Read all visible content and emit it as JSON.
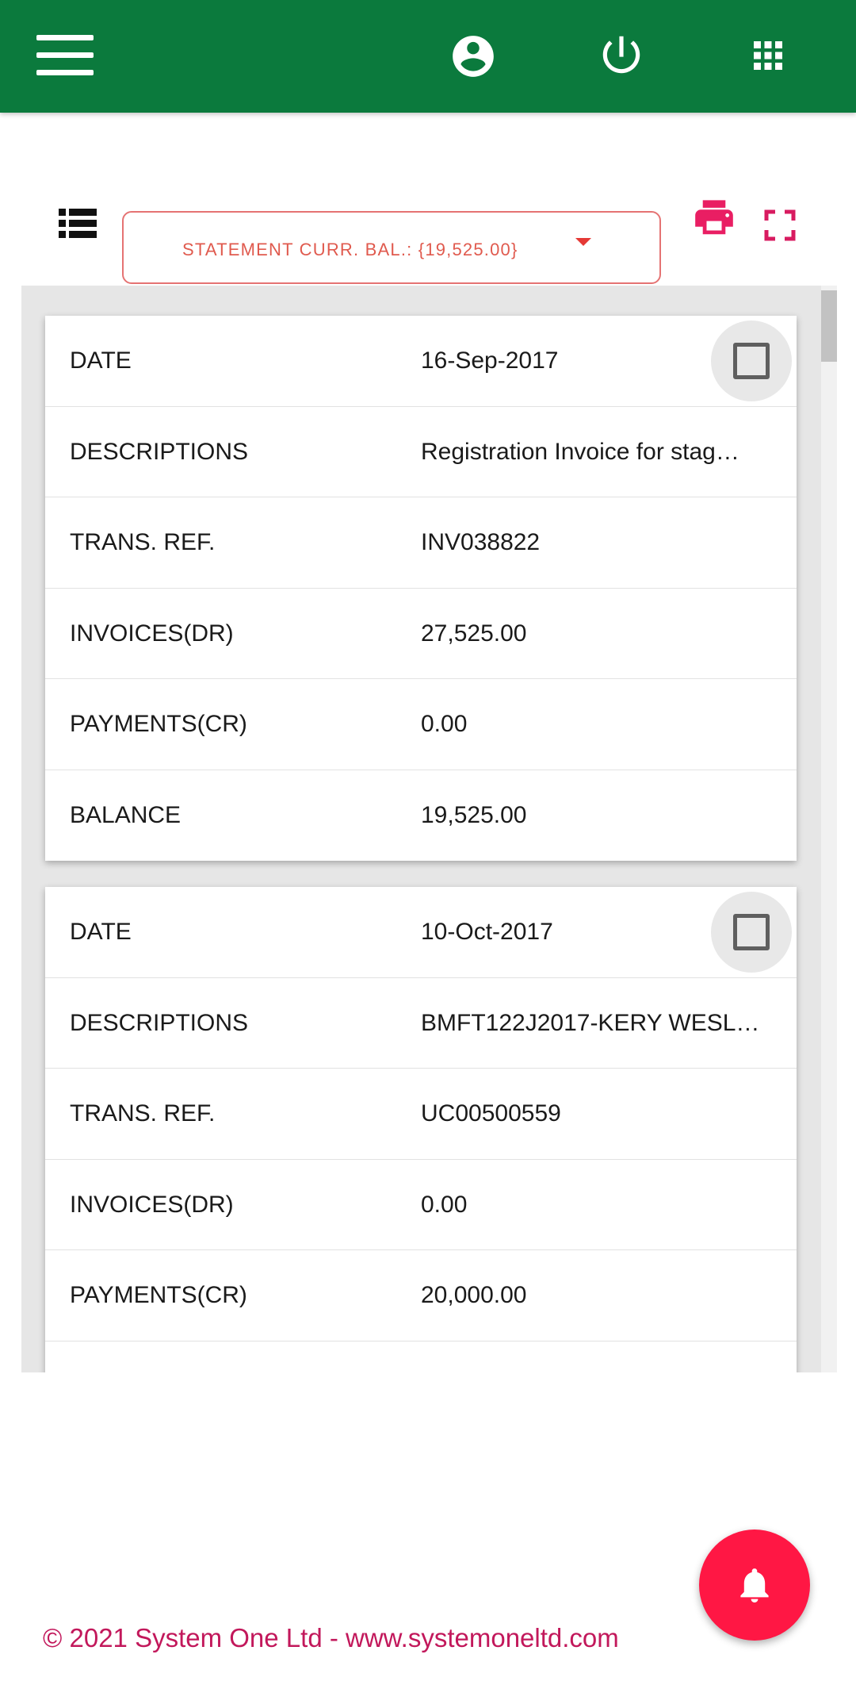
{
  "header": {
    "background": "#0b7a3d",
    "icons": [
      "menu-icon",
      "account-circle-icon",
      "power-icon",
      "apps-grid-icon"
    ]
  },
  "toolbar": {
    "balance_dropdown_label": "STATEMENT CURR. BAL.: {19,525.00}",
    "accent": "#e53935",
    "icons": [
      "list-view-icon",
      "print-icon",
      "fullscreen-icon"
    ]
  },
  "statement": {
    "fields": [
      "DATE",
      "DESCRIPTIONS",
      "TRANS. REF.",
      "INVOICES(DR)",
      "PAYMENTS(CR)",
      "BALANCE"
    ],
    "entries": [
      {
        "date": "16-Sep-2017",
        "description": "Registration Invoice for stag…",
        "trans_ref": "INV038822",
        "invoices_dr": "27,525.00",
        "payments_cr": "0.00",
        "balance": "19,525.00",
        "checked": false
      },
      {
        "date": "10-Oct-2017",
        "description": "BMFT122J2017-KERY WESL…",
        "trans_ref": "UC00500559",
        "invoices_dr": "0.00",
        "payments_cr": "20,000.00",
        "checked": false
      }
    ]
  },
  "fab": {
    "icon": "bell-icon",
    "color": "#ff1744"
  },
  "footer": {
    "copyright": "© 2021 System One Ltd - ",
    "link": "www.systemoneltd.com",
    "color": "#c2185b"
  }
}
